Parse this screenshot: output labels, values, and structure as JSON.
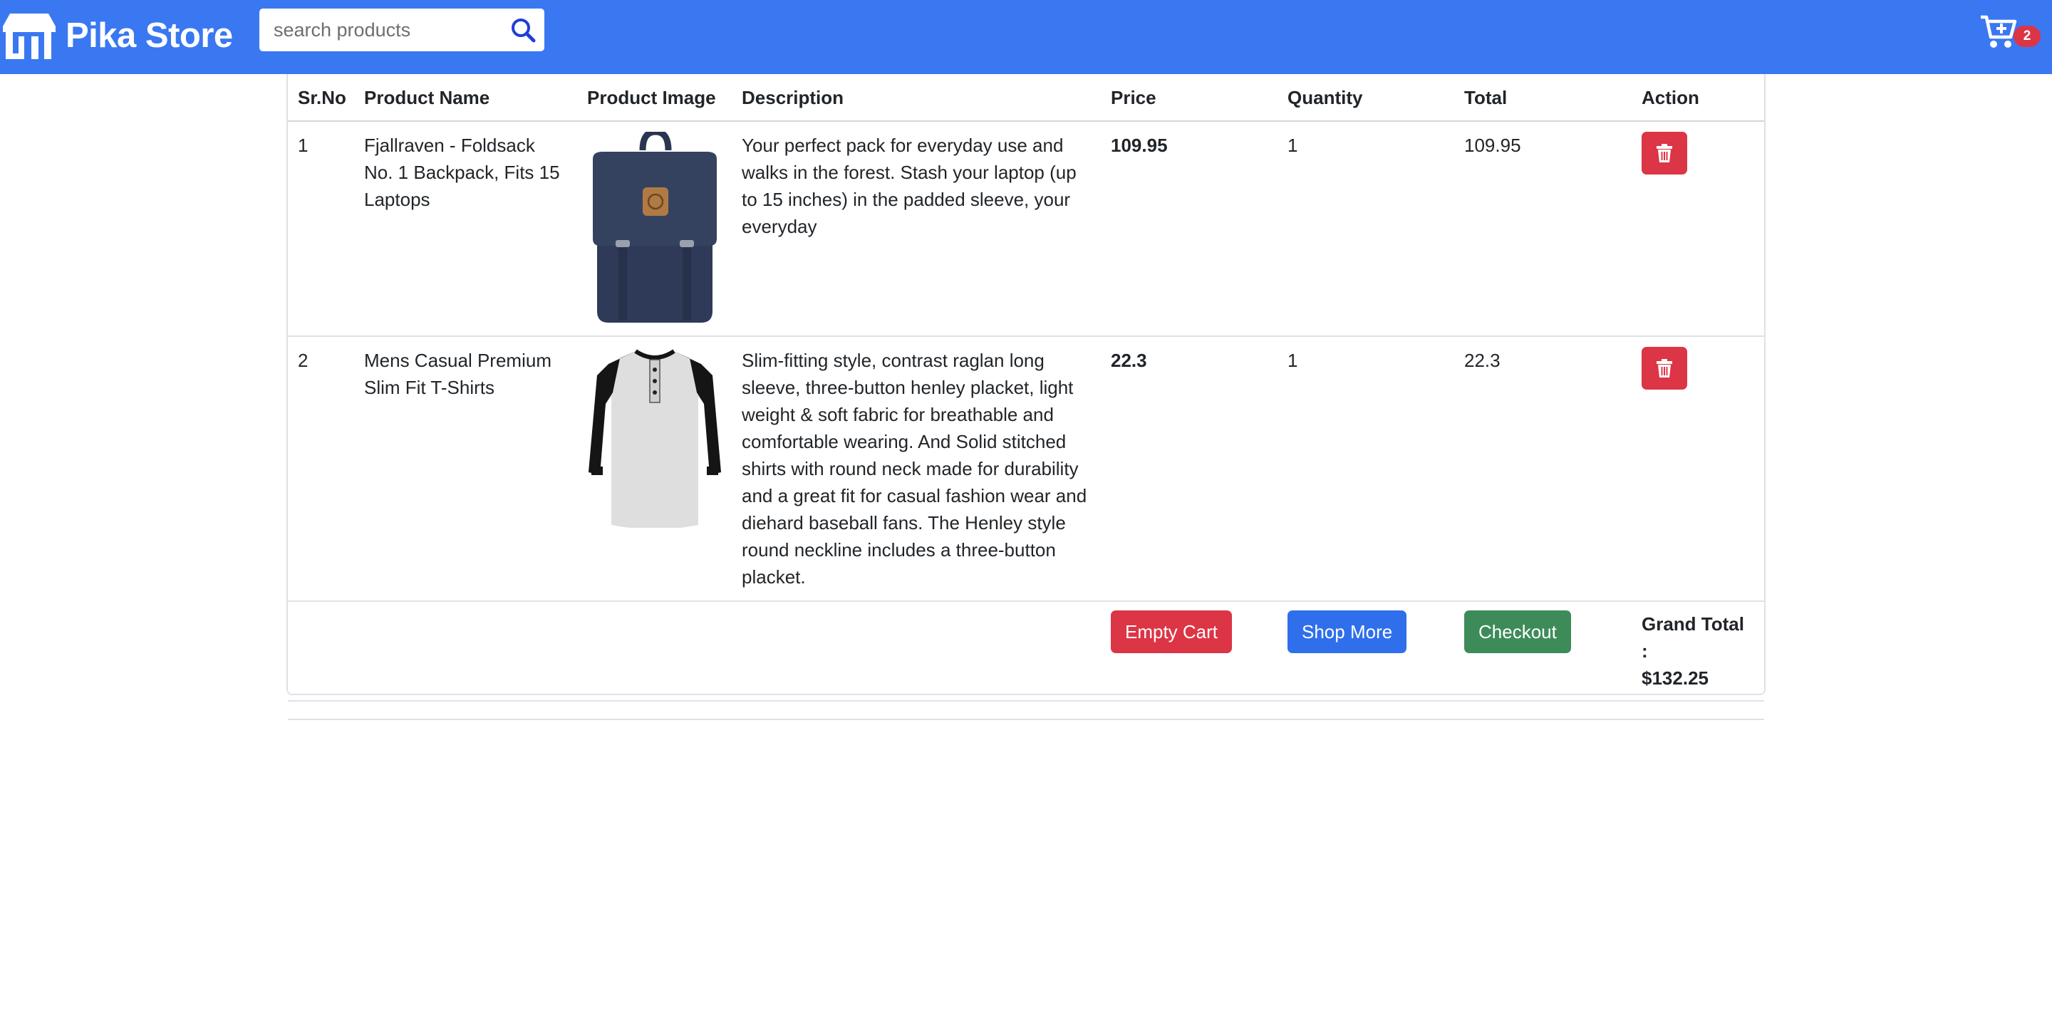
{
  "navbar": {
    "brand_name": "Pika Store",
    "search_placeholder": "search products",
    "cart_count": "2"
  },
  "table": {
    "headers": [
      "Sr.No",
      "Product Name",
      "Product Image",
      "Description",
      "Price",
      "Quantity",
      "Total",
      "Action"
    ],
    "rows": [
      {
        "sr": "1",
        "name": "Fjallraven - Foldsack No. 1 Backpack, Fits 15 Laptops",
        "image": "backpack-image",
        "description": "Your perfect pack for everyday use and walks in the forest. Stash your laptop (up to 15 inches) in the padded sleeve, your everyday",
        "price": "109.95",
        "quantity": "1",
        "total": "109.95"
      },
      {
        "sr": "2",
        "name": "Mens Casual Premium Slim Fit T-Shirts",
        "image": "tshirt-image",
        "description": "Slim-fitting style, contrast raglan long sleeve, three-button henley placket, light weight & soft fabric for breathable and comfortable wearing. And Solid stitched shirts with round neck made for durability and a great fit for casual fashion wear and diehard baseball fans. The Henley style round neckline includes a three-button placket.",
        "price": "22.3",
        "quantity": "1",
        "total": "22.3"
      }
    ]
  },
  "footer": {
    "empty_cart_label": "Empty Cart",
    "shop_more_label": "Shop More",
    "checkout_label": "Checkout",
    "grand_total_label": "Grand Total :",
    "grand_total_value": "$132.25"
  },
  "colors": {
    "navbar": "#3a78f2",
    "danger": "#dc3545",
    "primary": "#2f6fec",
    "success": "#3e8b5a"
  },
  "icons": {
    "brand": "store-icon",
    "search": "search-icon",
    "cart": "cart-plus-icon",
    "delete": "trash-icon"
  }
}
